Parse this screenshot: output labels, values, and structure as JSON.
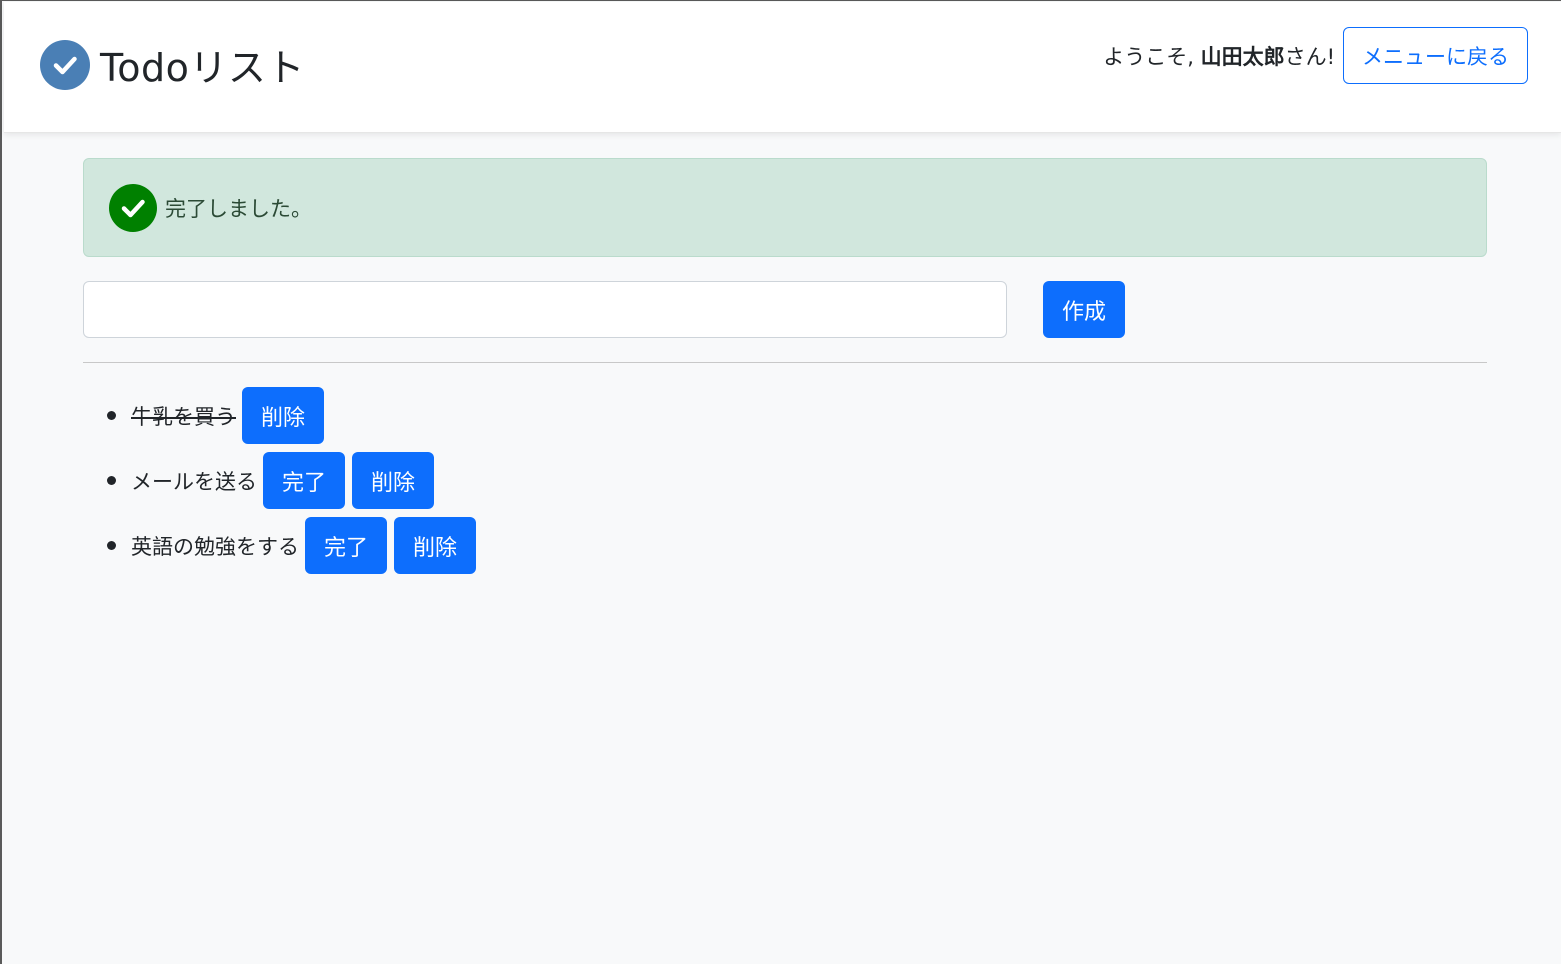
{
  "header": {
    "brand_title": "Todoリスト",
    "welcome_prefix": "ようこそ, ",
    "user_name": "山田太郎",
    "welcome_suffix": "さん!",
    "back_button_label": "メニューに戻る"
  },
  "alert": {
    "message": "完了しました。",
    "color": "#d1e7dd"
  },
  "form": {
    "input_value": "",
    "create_button_label": "作成"
  },
  "todos": [
    {
      "text": "牛乳を買う",
      "done": true,
      "delete_label": "削除"
    },
    {
      "text": "メールを送る",
      "done": false,
      "complete_label": "完了",
      "delete_label": "削除"
    },
    {
      "text": "英語の勉強をする",
      "done": false,
      "complete_label": "完了",
      "delete_label": "削除"
    }
  ],
  "colors": {
    "primary": "#0d6efd",
    "success_icon": "#008000",
    "brand_icon": "#4a7fb5"
  },
  "icons": {
    "brand": "check-circle-icon",
    "alert": "check-circle-icon"
  }
}
